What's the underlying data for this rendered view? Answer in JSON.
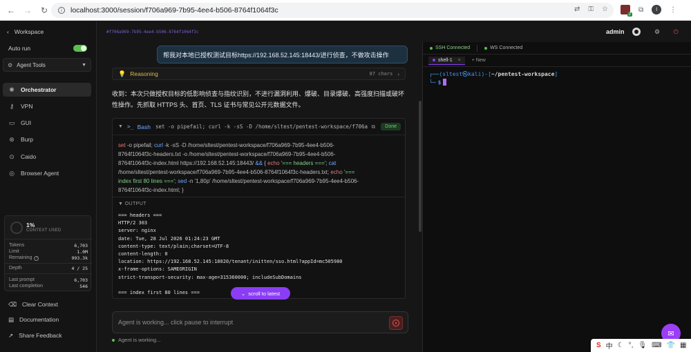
{
  "browser": {
    "url": "localhost:3000/session/f706a969-7b95-4ee4-b506-8764f1064f3c",
    "profile_initial": "l",
    "extension_badge": "2"
  },
  "sidebar": {
    "workspace_label": "Workspace",
    "autorun_label": "Auto run",
    "autorun_on": true,
    "agent_tools_label": "Agent Tools",
    "nav": [
      {
        "label": "Orchestrator",
        "icon": "orchestrator-icon",
        "active": true
      },
      {
        "label": "VPN",
        "icon": "key-icon"
      },
      {
        "label": "GUI",
        "icon": "monitor-icon"
      },
      {
        "label": "Burp",
        "icon": "burp-icon"
      },
      {
        "label": "Caido",
        "icon": "caido-icon"
      },
      {
        "label": "Browser Agent",
        "icon": "globe-icon"
      }
    ],
    "context": {
      "percent": "1%",
      "label": "CONTEXT USED",
      "tokens_label": "Tokens",
      "tokens": "6,703",
      "limit_label": "Limit",
      "limit": "1.0M",
      "remaining_label": "Remaining",
      "remaining": "993.3k",
      "depth_label": "Depth",
      "depth": "4 / 25",
      "last_prompt_label": "Last prompt",
      "last_prompt": "6,703",
      "last_completion_label": "Last completion",
      "last_completion": "546"
    },
    "bottom": [
      {
        "label": "Clear Context",
        "icon": "clear-icon"
      },
      {
        "label": "Documentation",
        "icon": "docs-icon"
      },
      {
        "label": "Share Feedback",
        "icon": "external-link-icon"
      }
    ]
  },
  "chat": {
    "session_hash": "#f706a969-7b95-4ee4-b506-8764f1064f3c",
    "user_message": "帮我对本地已授权测试目标https://192.168.52.145:18443/进行侦查，不做攻击操作",
    "reasoning_label": "Reasoning",
    "reasoning_chars": "87 chars",
    "assistant_text": "收到：本次只做授权目标的低影响侦查与指纹识别，不进行漏洞利用、爆破、目录爆破、高强度扫描或破坏性操作。先抓取 HTTPS 头、首页、TLS 证书与常见公开元数据文件。",
    "tool": {
      "name": "Bash",
      "command_preview": "set -o pipefail; curl -k -sS -D /home/sltest/pentest-workspace/f706a9...",
      "status": "Done",
      "code_lines": [
        [
          {
            "t": "set",
            "c": "k"
          },
          {
            "t": " -o pipefail; ",
            "c": ""
          },
          {
            "t": "curl",
            "c": "f"
          },
          {
            "t": " -k -sS -D /home/sltest/pentest-workspace/f706a969-7b95-4ee4-b506-",
            "c": ""
          }
        ],
        [
          {
            "t": "8764f1064f3c-headers.txt -o /home/sltest/pentest-workspace/f706a969-7b95-4ee4-b506-",
            "c": ""
          }
        ],
        [
          {
            "t": "8764f1064f3c-index.html https://192.168.52.145:18443/ ",
            "c": ""
          },
          {
            "t": "&&",
            "c": "f"
          },
          {
            "t": " { ",
            "c": ""
          },
          {
            "t": "echo",
            "c": "k"
          },
          {
            "t": " '=== headers ===';",
            "c": "s"
          },
          {
            "t": " cat",
            "c": "f"
          }
        ],
        [
          {
            "t": "/home/sltest/pentest-workspace/f706a969-7b95-4ee4-b506-8764f1064f3c-headers.txt; ",
            "c": ""
          },
          {
            "t": "echo",
            "c": "k"
          },
          {
            "t": " '===",
            "c": "s"
          }
        ],
        [
          {
            "t": "index first 80 lines ===';",
            "c": "s"
          },
          {
            "t": " sed",
            "c": "f"
          },
          {
            "t": " -n '1,80p' /home/sltest/pentest-workspace/f706a969-7b95-4ee4-b506-",
            "c": ""
          }
        ],
        [
          {
            "t": "8764f1064f3c-index.html; }",
            "c": ""
          }
        ]
      ],
      "output_label": "OUTPUT",
      "output": "=== headers ===\nHTTP/2 303\nserver: nginx\ndate: Tue, 28 Jul 2026 01:24:23 GMT\ncontent-type: text/plain;charset=UTF-8\ncontent-length: 0\nlocation: https://192.168.52.145:18020/tenant/initten/sso.html?appId=mc505980\nx-frame-options: SAMEORIGIN\nstrict-transport-security: max-age=315360000; includeSubDomains\n\n=== index first 80 lines ==="
    },
    "scroll_latest_label": "scroll to latest",
    "composer_placeholder": "Agent is working... click pause to interrupt",
    "status_text": "Agent is working..."
  },
  "header": {
    "user": "admin"
  },
  "terminal": {
    "ssh_status": "SSH Connected",
    "ws_status": "WS Connected",
    "tab_label": "shell-1",
    "new_tab_label": "+ New",
    "prompt_user": "sltest",
    "prompt_host": "kali",
    "prompt_path": "~/pentest-workspace",
    "prompt_symbol": "$"
  },
  "ime": {
    "lang": "中"
  }
}
